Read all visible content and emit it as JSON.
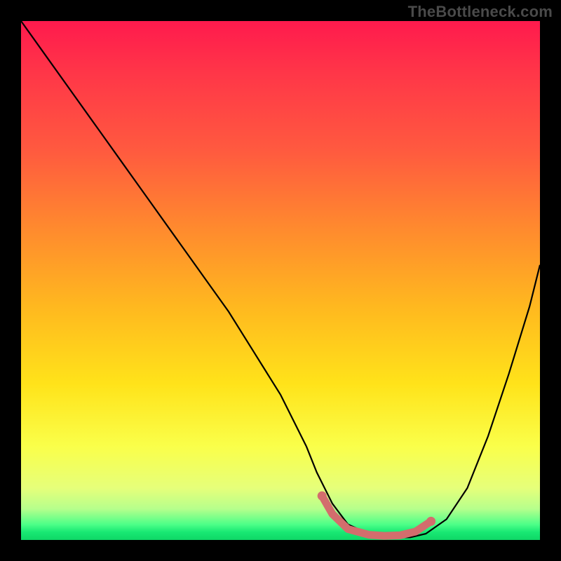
{
  "watermark": "TheBottleneck.com",
  "chart_data": {
    "type": "line",
    "title": "",
    "xlabel": "",
    "ylabel": "",
    "x_range": [
      0,
      100
    ],
    "y_range": [
      0,
      100
    ],
    "series": [
      {
        "name": "bottleneck-curve",
        "x": [
          0,
          5,
          10,
          15,
          20,
          25,
          30,
          35,
          40,
          45,
          50,
          55,
          57,
          60,
          63,
          67,
          70,
          73,
          75,
          78,
          82,
          86,
          90,
          94,
          98,
          100
        ],
        "y": [
          100,
          93,
          86,
          79,
          72,
          65,
          58,
          51,
          44,
          36,
          28,
          18,
          13,
          7,
          3,
          1.2,
          0.5,
          0.5,
          0.5,
          1.2,
          4,
          10,
          20,
          32,
          45,
          53
        ],
        "clip_top": "true"
      },
      {
        "name": "valley-highlight",
        "x": [
          58,
          60,
          63,
          67,
          70,
          73,
          76,
          79
        ],
        "y": [
          8.5,
          5.0,
          2.1,
          1.0,
          0.8,
          0.9,
          1.6,
          3.6
        ]
      }
    ],
    "styles": {
      "curve_stroke": "#000000",
      "curve_width": 2.2,
      "highlight_stroke": "#d36d6d",
      "highlight_width": 11,
      "highlight_cap_radius": 6.5
    },
    "note": "No numeric axis ticks are visible in the source image; x/y are normalized 0–100. Gradient colors encode an implicit red→green value scale (high bottleneck → low bottleneck)."
  }
}
